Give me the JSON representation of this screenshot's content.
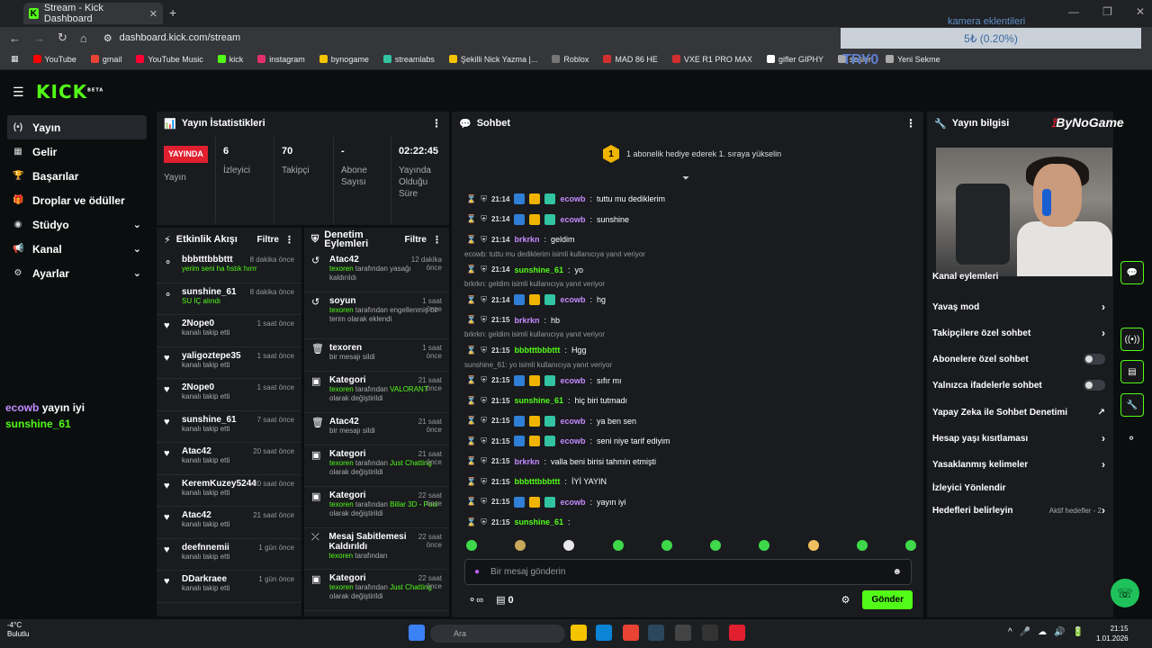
{
  "browser": {
    "tab_title": "Stream - Kick Dashboard",
    "url": "dashboard.kick.com/stream"
  },
  "overlay": {
    "title": "kamera eklentileri",
    "progress_text": "5₺ (0.20%)",
    "tryo": "TRY0"
  },
  "bookmarks": [
    {
      "label": "YouTube",
      "color": "#ff0000"
    },
    {
      "label": "gmail",
      "color": "#ea4335"
    },
    {
      "label": "YouTube Music",
      "color": "#ff0033"
    },
    {
      "label": "kick",
      "color": "#53fc18"
    },
    {
      "label": "instagram",
      "color": "#e1306c"
    },
    {
      "label": "bynogame",
      "color": "#f5c400"
    },
    {
      "label": "streamlabs",
      "color": "#31c3a2"
    },
    {
      "label": "Şekilli Nick Yazma |...",
      "color": "#f5c400"
    },
    {
      "label": "Roblox",
      "color": "#777777"
    },
    {
      "label": "MAD 86 HE",
      "color": "#d32f2f"
    },
    {
      "label": "VXE R1 PRO MAX",
      "color": "#d32f2f"
    },
    {
      "label": "gifler GIPHY",
      "color": "#ffffff"
    },
    {
      "label": "sesler",
      "color": "#aaaaaa"
    },
    {
      "label": "Yeni Sekme",
      "color": "#aaaaaa"
    }
  ],
  "nav": [
    {
      "label": "Yayın",
      "icon": "broadcast-icon",
      "active": true,
      "chev": false
    },
    {
      "label": "Gelir",
      "icon": "revenue-icon",
      "active": false,
      "chev": false
    },
    {
      "label": "Başarılar",
      "icon": "trophy-icon",
      "active": false,
      "chev": false
    },
    {
      "label": "Droplar ve ödüller",
      "icon": "gift-icon",
      "active": false,
      "chev": false
    },
    {
      "label": "Stüdyo",
      "icon": "studio-icon",
      "active": false,
      "chev": true
    },
    {
      "label": "Kanal",
      "icon": "megaphone-icon",
      "active": false,
      "chev": true
    },
    {
      "label": "Ayarlar",
      "icon": "gear-icon",
      "active": false,
      "chev": true
    }
  ],
  "chat_overlay": [
    {
      "user": "ecowb",
      "text": "yayın iyi",
      "color": "#c58cff"
    },
    {
      "user": "sunshine_61",
      "text": "",
      "color": "#53fc18"
    }
  ],
  "stats": {
    "title": "Yayın İstatistikleri",
    "live_label": "YAYINDA",
    "live_sub": "Yayın",
    "cells": [
      {
        "value": "6",
        "label": "İzleyici"
      },
      {
        "value": "70",
        "label": "Takipçi"
      },
      {
        "value": "-",
        "label": "Abone Sayısı"
      },
      {
        "value": "02:22:45",
        "label": "Yayında Olduğu Süre"
      }
    ]
  },
  "activity": {
    "title": "Etkinlik Akışı",
    "filter": "Filtre",
    "items": [
      {
        "name": "bbbtttbbbttt",
        "sub": "yerim seni ha fıstık hırrr",
        "time": "8 dakika önce",
        "green": true,
        "icon": "sub"
      },
      {
        "name": "sunshine_61",
        "sub": "SU İÇ alındı",
        "time": "8 dakika önce",
        "green": true,
        "icon": "sub"
      },
      {
        "name": "2Nope0",
        "sub": "kanalı takip etti",
        "time": "1 saat önce",
        "green": false,
        "icon": "heart"
      },
      {
        "name": "yaligoztepe35",
        "sub": "kanalı takip etti",
        "time": "1 saat önce",
        "green": false,
        "icon": "heart"
      },
      {
        "name": "2Nope0",
        "sub": "kanalı takip etti",
        "time": "1 saat önce",
        "green": false,
        "icon": "heart"
      },
      {
        "name": "sunshine_61",
        "sub": "kanalı takip etti",
        "time": "7 saat önce",
        "green": false,
        "icon": "heart"
      },
      {
        "name": "Atac42",
        "sub": "kanalı takip etti",
        "time": "20 saat önce",
        "green": false,
        "icon": "heart"
      },
      {
        "name": "KeremKuzey5244",
        "sub": "kanalı takip etti",
        "time": "20 saat önce",
        "green": false,
        "icon": "heart"
      },
      {
        "name": "Atac42",
        "sub": "kanalı takip etti",
        "time": "21 saat önce",
        "green": false,
        "icon": "heart"
      },
      {
        "name": "deefnnemii",
        "sub": "kanalı takip etti",
        "time": "1 gün önce",
        "green": false,
        "icon": "heart"
      },
      {
        "name": "DDarkraee",
        "sub": "kanalı takip etti",
        "time": "1 gün önce",
        "green": false,
        "icon": "heart"
      }
    ]
  },
  "audit": {
    "title": "Denetim Eylemleri",
    "filter": "Filtre",
    "items": [
      {
        "name": "Atac42",
        "actor": "texoren",
        "rest": " tarafından yasağı kaldırıldı",
        "extra": "",
        "tail": "",
        "time": "12 dakika önce",
        "icon": "↺"
      },
      {
        "name": "soyun",
        "actor": "texoren",
        "rest": " tarafından engellenmiş bir terim olarak eklendi",
        "extra": "",
        "tail": "",
        "time": "1 saat önce",
        "icon": "↺"
      },
      {
        "name": "texoren",
        "actor": "",
        "rest": "bir mesajı sildi",
        "extra": "",
        "tail": "",
        "time": "1 saat önce",
        "icon": "🗑"
      },
      {
        "name": "Kategori",
        "actor": "texoren",
        "rest": " tarafından ",
        "extra": "VALORANT",
        "tail": " olarak değiştirildi",
        "time": "21 saat önce",
        "icon": "▣"
      },
      {
        "name": "Atac42",
        "actor": "",
        "rest": "bir mesajı sildi",
        "extra": "",
        "tail": "",
        "time": "21 saat önce",
        "icon": "🗑"
      },
      {
        "name": "Kategori",
        "actor": "texoren",
        "rest": " tarafından ",
        "extra": "Just Chatting",
        "tail": " olarak değiştirildi",
        "time": "21 saat önce",
        "icon": "▣"
      },
      {
        "name": "Kategori",
        "actor": "texoren",
        "rest": " tarafından ",
        "extra": "Billar 3D - Pool",
        "tail": " olarak değiştirildi",
        "time": "22 saat önce",
        "icon": "▣"
      },
      {
        "name": "Mesaj Sabitlemesi Kaldırıldı",
        "actor": "texoren",
        "rest": " tarafından",
        "extra": "",
        "tail": "",
        "time": "22 saat önce",
        "icon": "⤫"
      },
      {
        "name": "Kategori",
        "actor": "texoren",
        "rest": " tarafından ",
        "extra": "Just Chatting",
        "tail": " olarak değiştirildi",
        "time": "22 saat önce",
        "icon": "▣"
      }
    ]
  },
  "chat": {
    "title": "Sohbet",
    "gift_rank": "1",
    "gift_text": "1 abonelik hediye ederek 1. sıraya yükselin",
    "placeholder": "Bir mesaj gönderin",
    "points": "0",
    "send": "Gönder",
    "messages": [
      {
        "reply": "",
        "time": "21:14",
        "user": "ecowb",
        "color": "#c58cff",
        "badges": true,
        "text": "tuttu mu dediklerim"
      },
      {
        "reply": "",
        "time": "21:14",
        "user": "ecowb",
        "color": "#c58cff",
        "badges": true,
        "text": "sunshine"
      },
      {
        "reply": "",
        "time": "21:14",
        "user": "brkrkn",
        "color": "#c58cff",
        "badges": false,
        "text": "geldim"
      },
      {
        "reply": "ecowb: tuttu mu dediklerim isimli kullanıcıya yanıt veriyor",
        "time": "21:14",
        "user": "sunshine_61",
        "color": "#53fc18",
        "badges": false,
        "text": "yo"
      },
      {
        "reply": "brkrkn: geldim isimli kullanıcıya yanıt veriyor",
        "time": "21:14",
        "user": "ecowb",
        "color": "#c58cff",
        "badges": true,
        "text": "hg"
      },
      {
        "reply": "",
        "time": "21:15",
        "user": "brkrkn",
        "color": "#c58cff",
        "badges": false,
        "text": "hb"
      },
      {
        "reply": "brkrkn: geldim isimli kullanıcıya yanıt veriyor",
        "time": "21:15",
        "user": "bbbtttbbbttt",
        "color": "#53fc18",
        "badges": false,
        "text": "Hgg"
      },
      {
        "reply": "sunshine_61: yo isimli kullanıcıya yanıt veriyor",
        "time": "21:15",
        "user": "ecowb",
        "color": "#c58cff",
        "badges": true,
        "text": "sıfır mı"
      },
      {
        "reply": "",
        "time": "21:15",
        "user": "sunshine_61",
        "color": "#53fc18",
        "badges": false,
        "text": "hiç biri tutmadı"
      },
      {
        "reply": "",
        "time": "21:15",
        "user": "ecowb",
        "color": "#c58cff",
        "badges": true,
        "text": "ya ben sen"
      },
      {
        "reply": "",
        "time": "21:15",
        "user": "ecowb",
        "color": "#c58cff",
        "badges": true,
        "text": "seni niye tarif ediyim"
      },
      {
        "reply": "",
        "time": "21:15",
        "user": "brkrkn",
        "color": "#c58cff",
        "badges": false,
        "text": "valla beni birisi tahmin etmişti"
      },
      {
        "reply": "",
        "time": "21:15",
        "user": "bbbtttbbbttt",
        "color": "#53fc18",
        "badges": false,
        "text": "İYİ YAYIN"
      },
      {
        "reply": "",
        "time": "21:15",
        "user": "ecowb",
        "color": "#c58cff",
        "badges": true,
        "text": "yayın iyi"
      },
      {
        "reply": "",
        "time": "21:15",
        "user": "sunshine_61",
        "color": "#53fc18",
        "badges": false,
        "text": ""
      }
    ]
  },
  "info": {
    "title": "Yayın bilgisi",
    "sponsor": "ByNoGame",
    "settings": [
      {
        "label": "Kanal eylemleri",
        "type": "none"
      },
      {
        "label": "Yavaş mod",
        "type": "chev"
      },
      {
        "label": "Takipçilere özel sohbet",
        "type": "chev"
      },
      {
        "label": "Abonelere özel sohbet",
        "type": "toggle"
      },
      {
        "label": "Yalnızca ifadelerle sohbet",
        "type": "toggle"
      },
      {
        "label": "Yapay Zeka ile Sohbet Denetimi",
        "type": "ext"
      },
      {
        "label": "Hesap yaşı kısıtlaması",
        "type": "chev"
      },
      {
        "label": "Yasaklanmış kelimeler",
        "type": "chev"
      },
      {
        "label": "İzleyici Yönlendir",
        "type": "none"
      },
      {
        "label": "Hedefleri belirleyin",
        "type": "goal",
        "extra": "Aktif hedefler - 2"
      }
    ]
  },
  "taskbar": {
    "temp": "-4°C",
    "weather": "Bulutlu",
    "search": "Ara",
    "time": "21:15",
    "date": "1.01.2026"
  },
  "colors": {
    "accent": "#53fc18",
    "live": "#e0202f"
  }
}
